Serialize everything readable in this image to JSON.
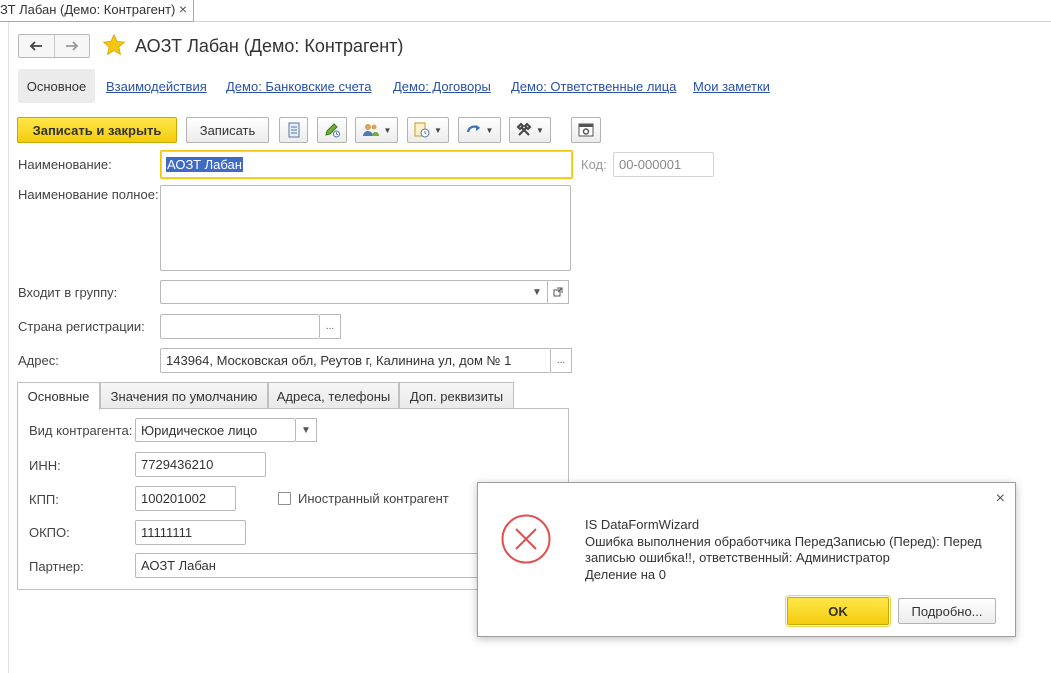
{
  "window": {
    "tab_title": "ЗТ Лабан (Демо: Контрагент)",
    "tab_close": "×"
  },
  "header": {
    "title": "АОЗТ Лабан (Демо: Контрагент)"
  },
  "sections": {
    "active": "Основное",
    "links": [
      "Взаимодействия",
      "Демо: Банковские счета",
      "Демо: Договоры",
      "Демо: Ответственные лица",
      "Мои заметки"
    ]
  },
  "toolbar": {
    "save_close_label": "Записать и закрыть",
    "save_label": "Записать"
  },
  "form": {
    "name_label": "Наименование:",
    "name_value": "АОЗТ Лабан",
    "code_label": "Код:",
    "code_value": "00-000001",
    "full_name_label": "Наименование полное:",
    "full_name_value": "",
    "group_label": "Входит в группу:",
    "group_value": "",
    "country_label": "Страна регистрации:",
    "country_value": "",
    "address_label": "Адрес:",
    "address_value": "143964, Московская обл, Реутов г, Калинина ул, дом № 1",
    "ellipsis": "..."
  },
  "tabs": [
    "Основные",
    "Значения по умолчанию",
    "Адреса, телефоны",
    "Доп. реквизиты"
  ],
  "main_tab": {
    "kind_label": "Вид контрагента:",
    "kind_value": "Юридическое лицо",
    "inn_label": "ИНН:",
    "inn_value": "7729436210",
    "kpp_label": "КПП:",
    "kpp_value": "100201002",
    "foreign_label": "Иностранный контрагент",
    "okpo_label": "ОКПО:",
    "okpo_value": "11111111",
    "partner_label": "Партнер:",
    "partner_value": "АОЗТ Лабан"
  },
  "dialog": {
    "line1": "IS DataFormWizard",
    "line2": "Ошибка выполнения обработчика ПередЗаписью (Перед): Перед",
    "line3": "записью ошибка!!, ответственный: Администратор",
    "line4": "Деление на 0",
    "ok_label": "OK",
    "more_label": "Подробно...",
    "close": "×"
  },
  "colors": {
    "accent_yellow": "#f4cc0c",
    "link_blue": "#2a52a0",
    "error_red": "#e05050",
    "selection_blue": "#3f6bc3"
  }
}
